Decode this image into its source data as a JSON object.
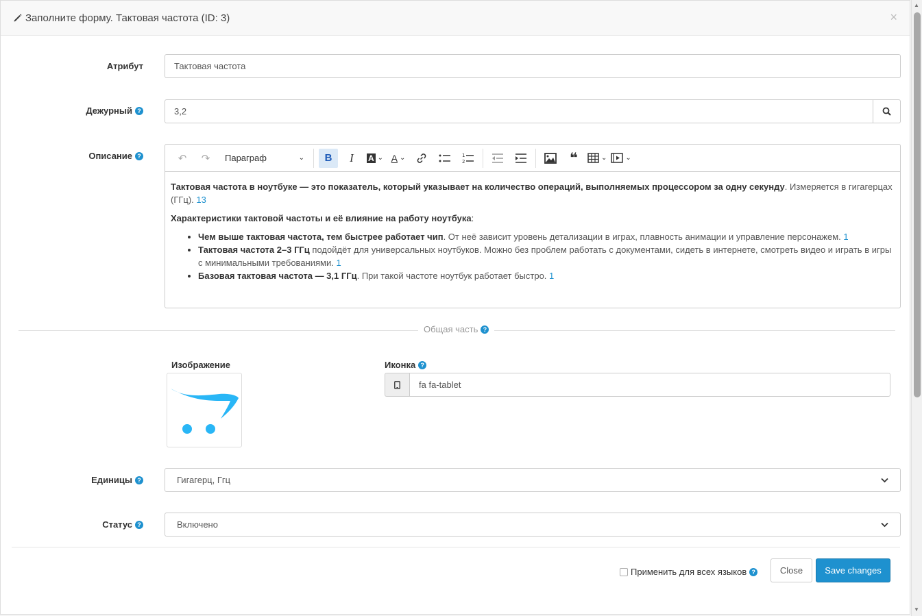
{
  "header": {
    "title": "Заполните форму. Тактовая частота (ID: 3)",
    "close_symbol": "×"
  },
  "attribute": {
    "label": "Атрибут",
    "value": "Тактовая частота"
  },
  "duty": {
    "label": "Дежурный",
    "value": "3,2"
  },
  "description": {
    "label": "Описание",
    "paragraph_select": "Параграф",
    "p1_bold": "Тактовая частота в ноутбуке — это показатель, который указывает на количество операций, выполняемых процессором за одну секунду",
    "p1_rest": ". Измеряется в гигагерцах (ГГц). ",
    "p1_ref": "13",
    "p2_bold": "Характеристики тактовой частоты и её влияние на работу ноутбука",
    "p2_rest": ":",
    "items": [
      {
        "bold": "Чем выше тактовая частота, тем быстрее работает чип",
        "rest": ". От неё зависит уровень детализации в играх, плавность анимации и управление персонажем. ",
        "ref": "1"
      },
      {
        "bold": "Тактовая частота 2–3 ГГц",
        "rest": " подойдёт для универсальных ноутбуков. Можно без проблем работать с документами, сидеть в интернете, смотреть видео и играть в игры с минимальными требованиями. ",
        "ref": "1"
      },
      {
        "bold": "Базовая тактовая частота — 3,1 ГГц",
        "rest": ". При такой частоте ноутбук работает быстро. ",
        "ref": "1"
      }
    ]
  },
  "common": {
    "label": "Общая часть"
  },
  "image": {
    "label": "Изображение"
  },
  "icon": {
    "label": "Иконка",
    "value": "fa fa-tablet"
  },
  "units": {
    "label": "Единицы",
    "value": "Гигагерц, Ггц"
  },
  "status": {
    "label": "Статус",
    "value": "Включено"
  },
  "footer": {
    "apply_all_label": "Применить для всех языков",
    "close_label": "Close",
    "save_label": "Save changes"
  },
  "colors": {
    "accent": "#1e91cf",
    "logo": "#29b6f6"
  }
}
